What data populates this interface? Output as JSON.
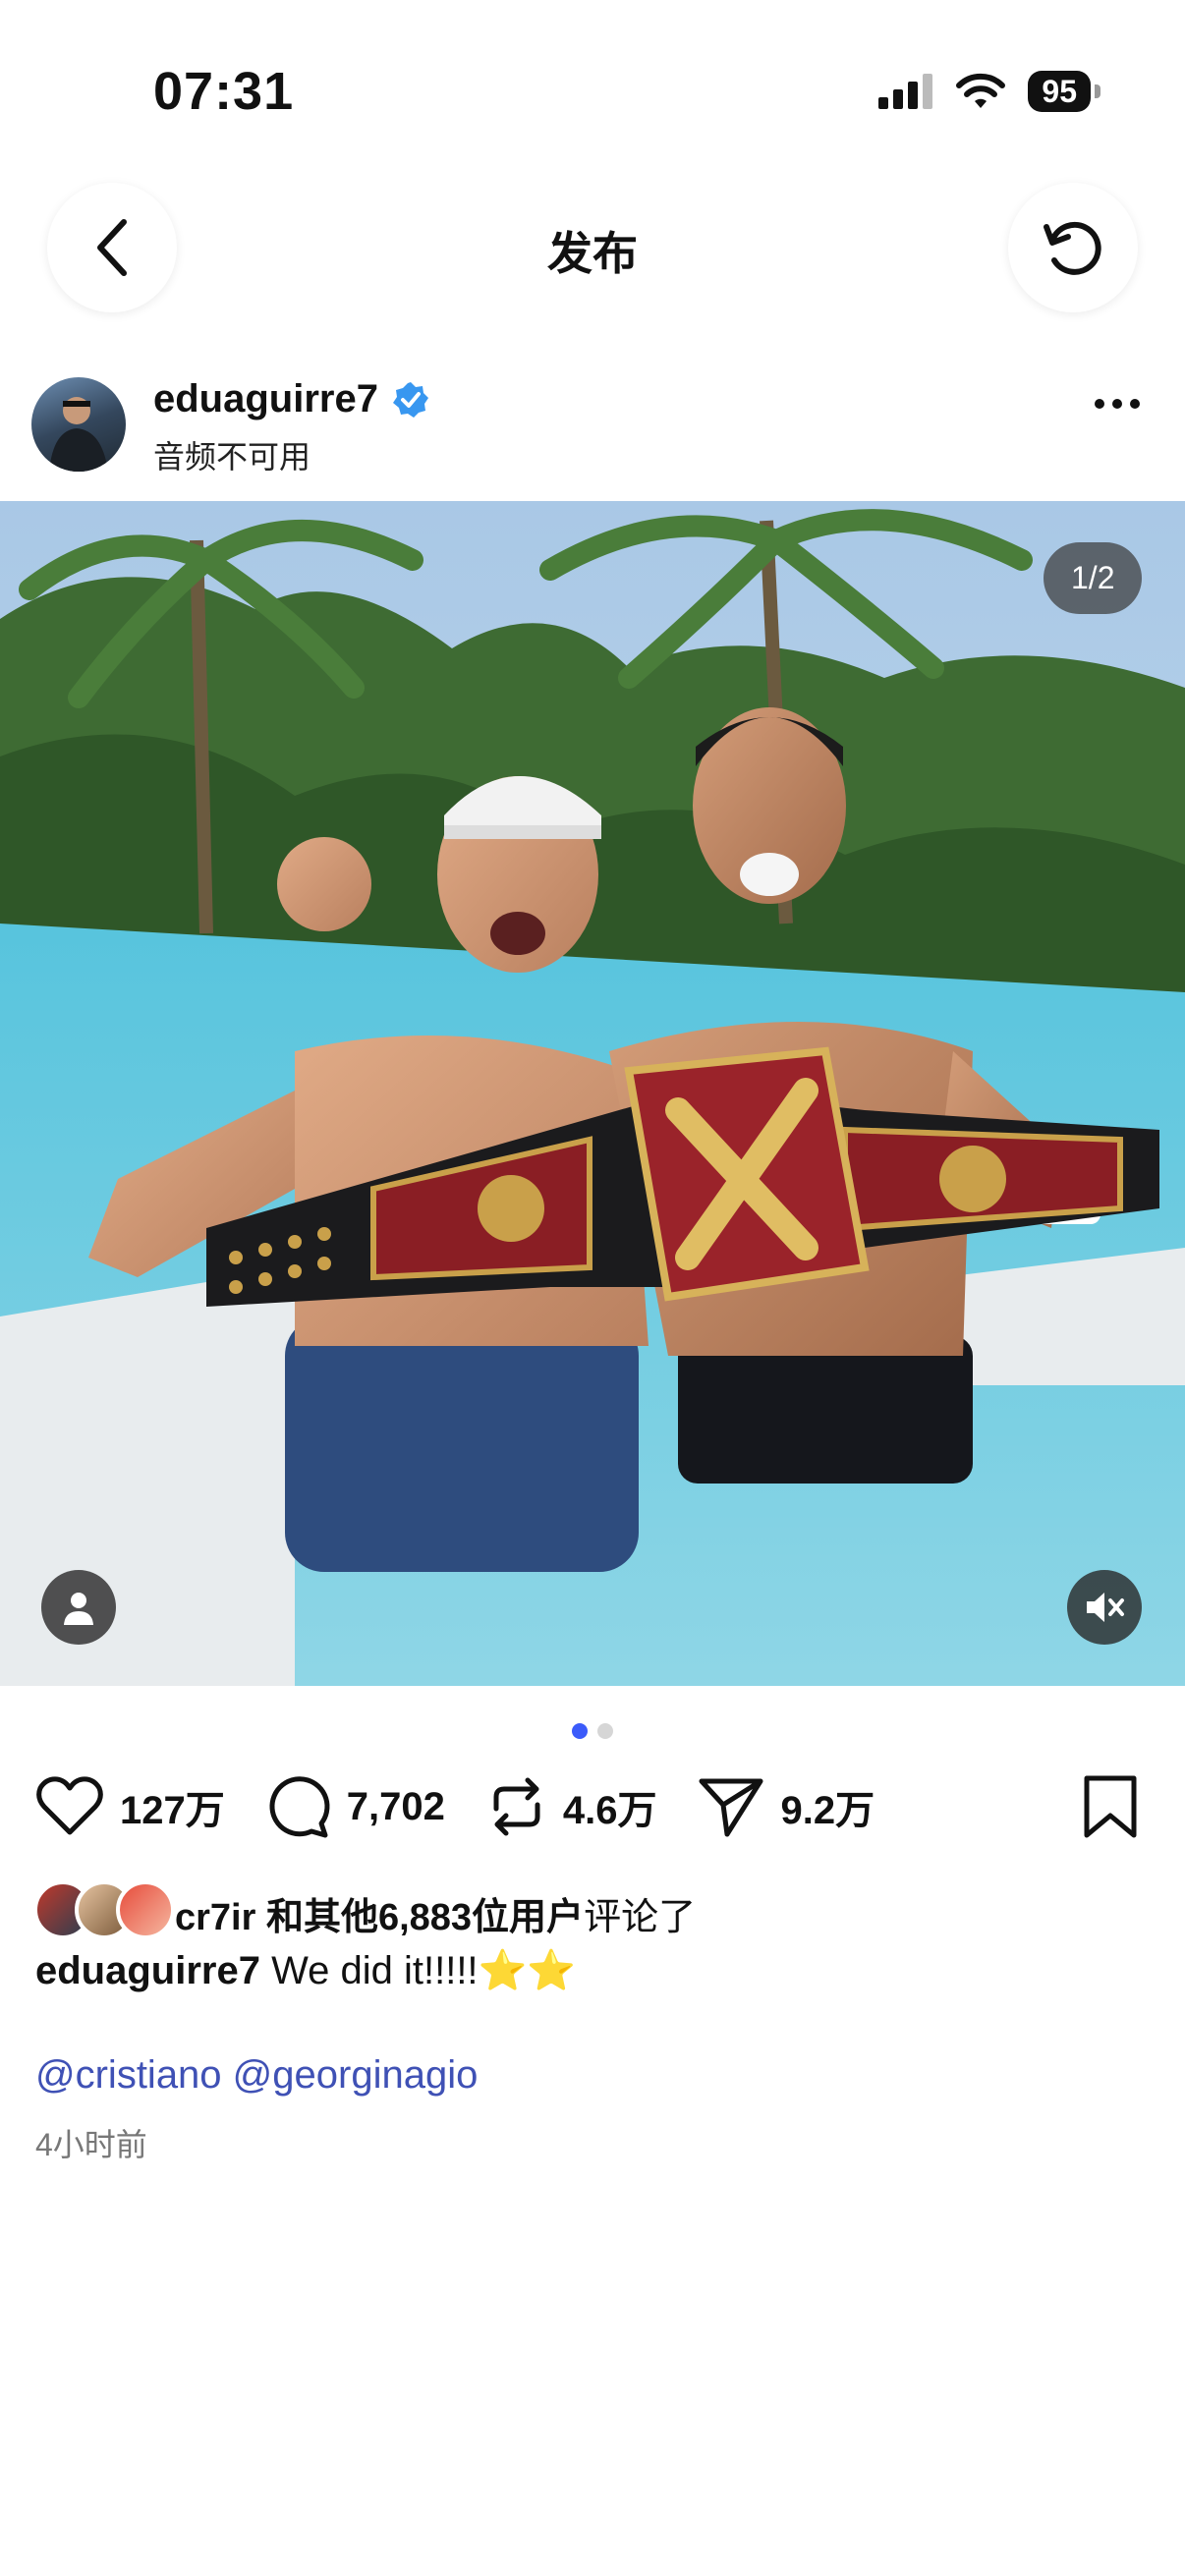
{
  "status_bar": {
    "time": "07:31",
    "battery": "95"
  },
  "header": {
    "title": "发布"
  },
  "post": {
    "username": "eduaguirre7",
    "verified": true,
    "subline": "音频不可用",
    "image_counter": "1/2",
    "carousel": {
      "count": 2,
      "active": 1
    },
    "likes": "127万",
    "comments": "7,702",
    "reposts": "4.6万",
    "shares": "9.2万",
    "commenter_name": "cr7ir",
    "commenter_rest": "和其他6,883位用户",
    "commenter_suffix": "评论了",
    "caption_user": "eduaguirre7",
    "caption_text": "We did it!!!!!⭐⭐",
    "mentions": "@cristiano @georginagio",
    "time_ago": "4小时前"
  },
  "colors": {
    "accent": "#3b5bfa",
    "link": "#3f51b5",
    "verified": "#3897f0"
  }
}
